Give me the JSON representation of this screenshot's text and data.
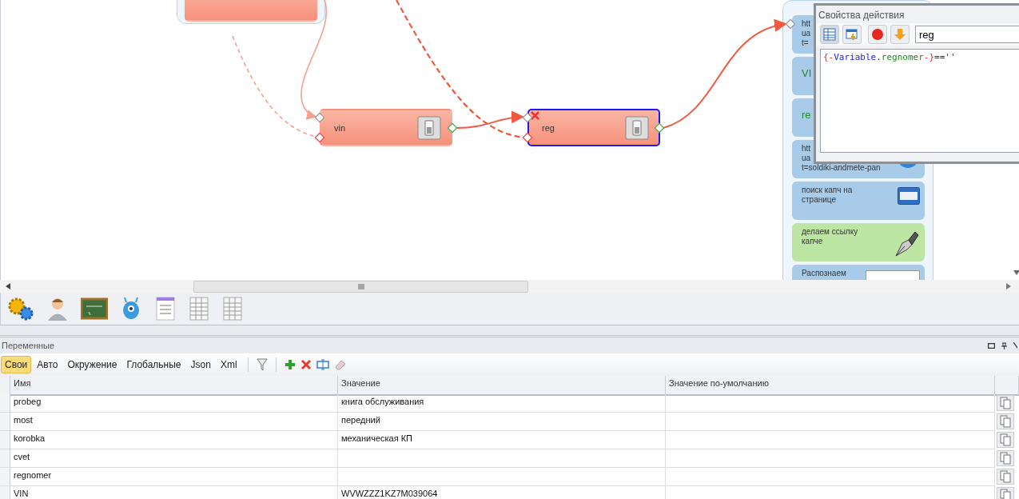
{
  "canvas": {
    "nodes": [
      {
        "selected": false
      },
      {
        "label": "vin",
        "selected": false,
        "error": false
      },
      {
        "label": "reg",
        "selected": true,
        "error": true
      }
    ],
    "group_cards": [
      {
        "lines": [
          "htt",
          "ua",
          "t="
        ],
        "kind": "action",
        "color": "#a9cbea"
      },
      {
        "lines": [
          "VI"
        ],
        "kind": "variable",
        "color": "#a9cbea"
      },
      {
        "lines": [
          "re"
        ],
        "kind": "variable",
        "color": "#a9cbea"
      },
      {
        "lines": [
          "htt",
          "ua",
          "t=soldiki-andmete-pan"
        ],
        "kind": "action",
        "color": "#a9cbea"
      },
      {
        "lines": [
          "поиск капч на",
          "странице"
        ],
        "kind": "action",
        "color": "#a9cbea"
      },
      {
        "lines": [
          "делаем ссылку",
          "капче"
        ],
        "kind": "action",
        "color": "#bde5a4"
      },
      {
        "lines": [
          "Распознаем"
        ],
        "kind": "action",
        "color": "#a9cbea"
      }
    ]
  },
  "properties_dialog": {
    "title": "Свойства действия",
    "name_value": "reg",
    "code": [
      {
        "text": "{-",
        "kind": "delimiter"
      },
      {
        "text": "Variable",
        "kind": "keyword"
      },
      {
        "text": ".",
        "kind": "plain"
      },
      {
        "text": "regnomer",
        "kind": "name"
      },
      {
        "text": "-}",
        "kind": "delimiter"
      },
      {
        "text": "==''",
        "kind": "plain"
      }
    ]
  },
  "variables_panel": {
    "title": "Переменные",
    "tabs": [
      {
        "label": "Свои",
        "selected": true
      },
      {
        "label": "Авто",
        "selected": false
      },
      {
        "label": "Окружение",
        "selected": false
      },
      {
        "label": "Глобальные",
        "selected": false
      },
      {
        "label": "Json",
        "selected": false
      },
      {
        "label": "Xml",
        "selected": false
      }
    ],
    "table": {
      "columns": [
        "Имя",
        "Значение",
        "Значение по-умолчанию"
      ],
      "rows": [
        [
          "probeg",
          "книга обслуживания",
          ""
        ],
        [
          "most",
          "передний",
          ""
        ],
        [
          "korobka",
          "механическая КП",
          ""
        ],
        [
          "cvet",
          "",
          ""
        ],
        [
          "regnomer",
          "",
          ""
        ],
        [
          "VIN",
          "WVWZZZ1KZ7M039064",
          ""
        ]
      ]
    }
  }
}
